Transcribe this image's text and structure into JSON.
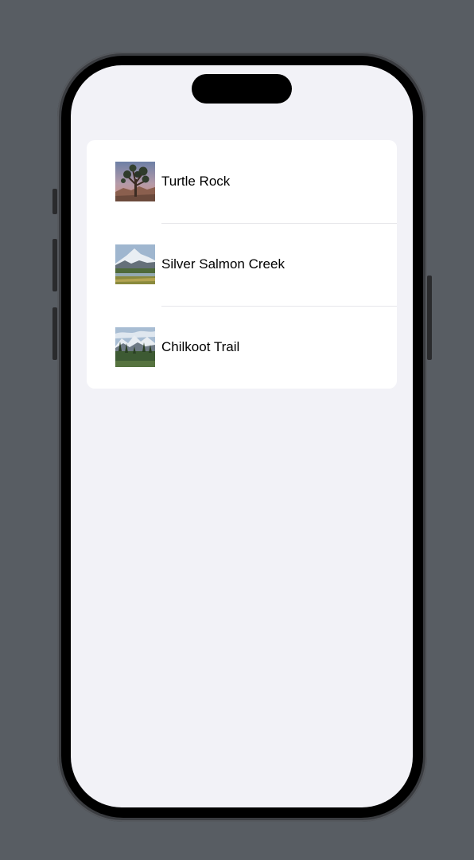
{
  "app": {
    "list": {
      "items": [
        {
          "label": "Turtle Rock",
          "icon": "joshua-tree-photo"
        },
        {
          "label": "Silver Salmon Creek",
          "icon": "snowy-mountain-meadow-photo"
        },
        {
          "label": "Chilkoot Trail",
          "icon": "mountain-forest-photo"
        }
      ]
    }
  },
  "colors": {
    "device_background": "#585d63",
    "screen_background": "#f2f2f7",
    "card_background": "#ffffff",
    "separator": "#e6e6ea",
    "text": "#000000"
  }
}
